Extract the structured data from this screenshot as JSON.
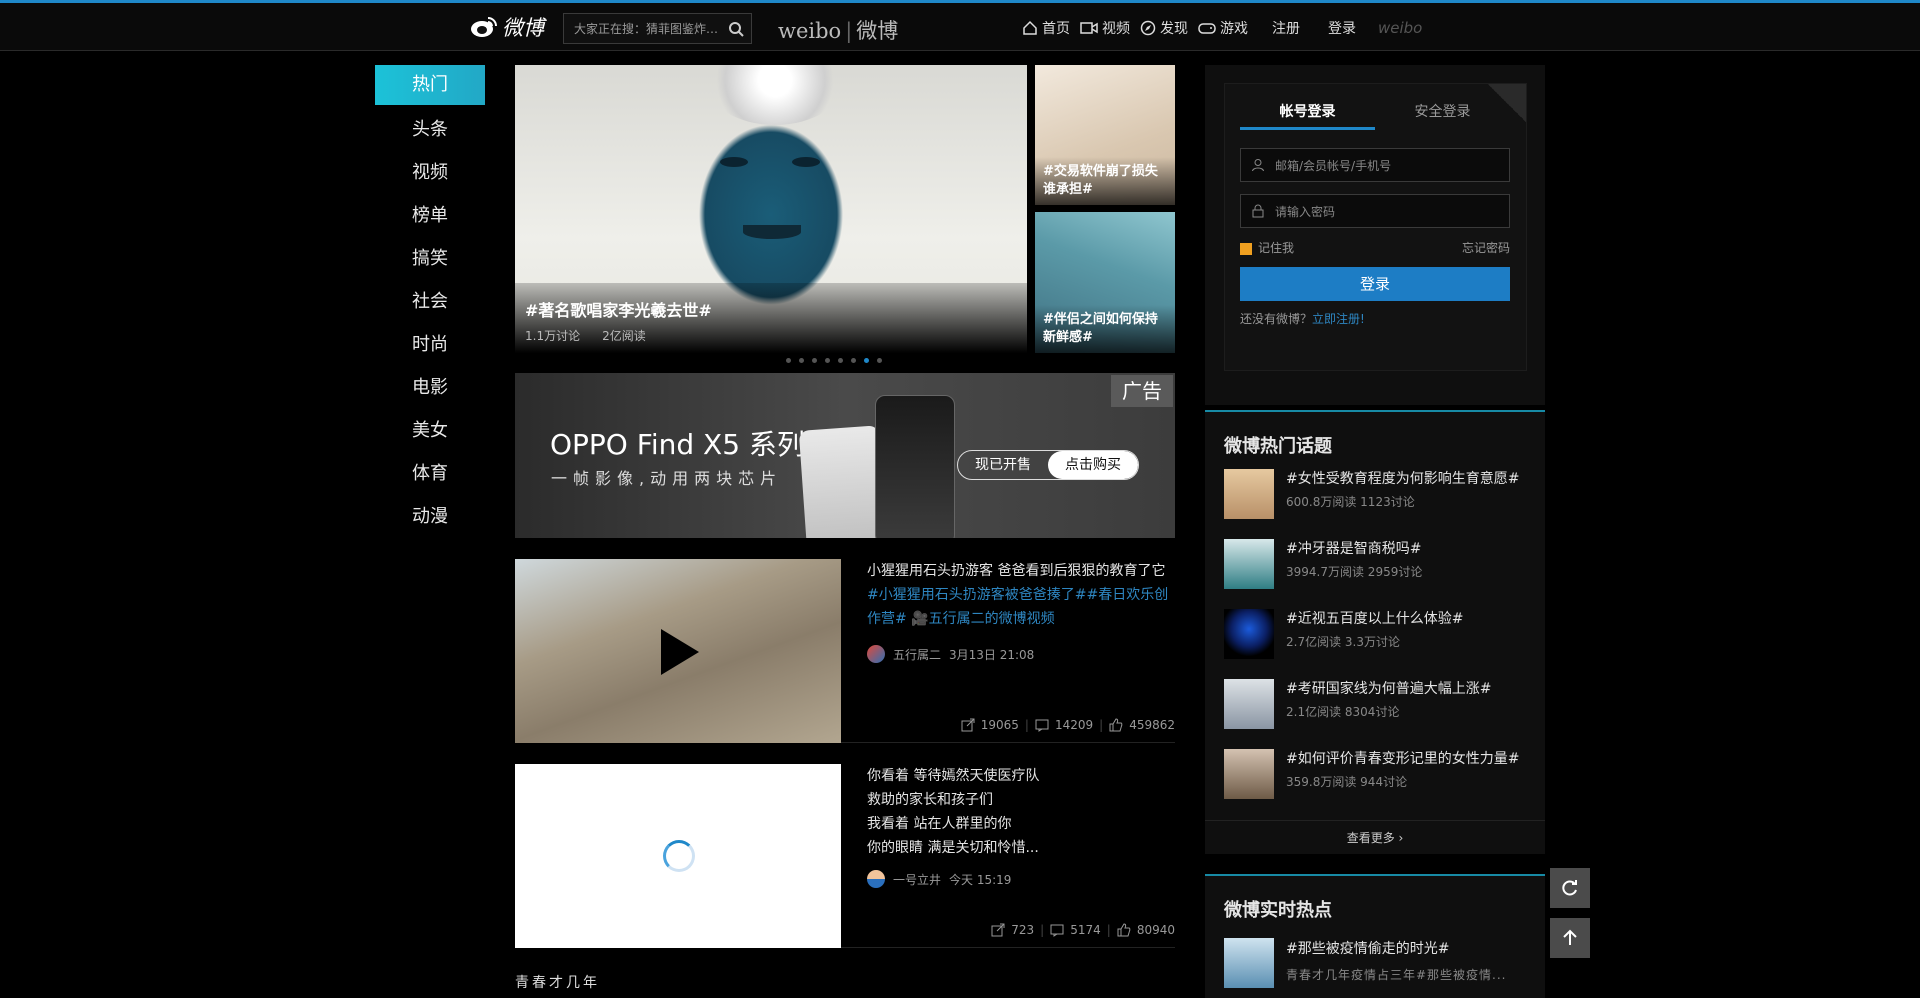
{
  "header": {
    "logo_text": "微博",
    "search_placeholder": "大家正在搜：猜菲图鉴炸…",
    "brand_en": "weibo",
    "brand_cn": "微博",
    "nav": [
      "首页",
      "视频",
      "发现",
      "游戏"
    ],
    "register": "注册",
    "login": "登录",
    "brand_small": "weibo"
  },
  "leftnav": {
    "items": [
      "热门",
      "头条",
      "视频",
      "榜单",
      "搞笑",
      "社会",
      "时尚",
      "电影",
      "美女",
      "体育",
      "动漫"
    ],
    "active_index": 0
  },
  "carousel": {
    "main": {
      "title": "#著名歌唱家李光羲去世#",
      "discussions": "1.1万讨论",
      "reads": "2亿阅读"
    },
    "side": [
      {
        "title": "#交易软件崩了损失谁承担#"
      },
      {
        "title": "#伴侣之间如何保持新鲜感#"
      }
    ],
    "dots": 8,
    "active_dot": 6
  },
  "ad": {
    "tag": "广告",
    "headline": "OPPO Find X5 系列",
    "subline": "一帧影像,动用两块芯片",
    "btn_left": "现已开售",
    "btn_right": "点击购买"
  },
  "feed": [
    {
      "text": "小猩猩用石头扔游客 爸爸看到后狠狠的教育了它",
      "link": "#小猩猩用石头扔游客被爸爸揍了##春日欢乐创作营# 🎥五行属二的微博视频",
      "author": "五行属二",
      "time": "3月13日 21:08",
      "reposts": "19065",
      "comments": "14209",
      "likes": "459862"
    },
    {
      "lines": [
        "你看着 等待嫣然天使医疗队",
        "救助的家长和孩子们",
        "我看着 站在人群里的你",
        "你的眼睛 满是关切和怜惜..."
      ],
      "author": "一号立井",
      "time": "今天 15:19",
      "reposts": "723",
      "comments": "5174",
      "likes": "80940"
    }
  ],
  "bottom_text": "青春才几年",
  "login": {
    "tab_account": "帐号登录",
    "tab_secure": "安全登录",
    "username_placeholder": "邮箱/会员帐号/手机号",
    "password_placeholder": "请输入密码",
    "remember": "记住我",
    "forgot": "忘记密码",
    "submit": "登录",
    "no_account": "还没有微博？",
    "register_link": "立即注册!"
  },
  "hot_topics": {
    "title": "微博热门话题",
    "items": [
      {
        "title": "#女性受教育程度为何影响生育意愿#",
        "stats": "600.8万阅读 1123讨论"
      },
      {
        "title": "#冲牙器是智商税吗#",
        "stats": "3994.7万阅读 2959讨论"
      },
      {
        "title": "#近视五百度以上什么体验#",
        "stats": "2.7亿阅读 3.3万讨论"
      },
      {
        "title": "#考研国家线为何普遍大幅上涨#",
        "stats": "2.1亿阅读 8304讨论"
      },
      {
        "title": "#如何评价青春变形记里的女性力量#",
        "stats": "359.8万阅读 944讨论"
      }
    ],
    "more": "查看更多 ›"
  },
  "realtime": {
    "title": "微博实时热点",
    "item_title": "#那些被疫情偷走的时光#",
    "item_sub": "青春才几年疫情占三年#那些被疫情..."
  },
  "colors": {
    "accent": "#1f88c9",
    "active_nav": "#1cc2d8",
    "link": "#2e86c1"
  }
}
